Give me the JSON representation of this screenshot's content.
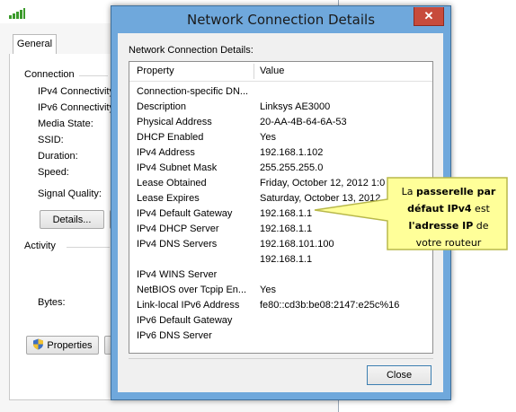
{
  "background_window": {
    "tab_general": "General",
    "connection_group": "Connection",
    "fields": [
      "IPv4 Connectivity:",
      "IPv6 Connectivity:",
      "Media State:",
      "SSID:",
      "Duration:",
      "Speed:"
    ],
    "signal_quality": "Signal Quality:",
    "details_button": "Details...",
    "activity_group": "Activity",
    "bytes_label": "Bytes:",
    "properties_button": "Properties"
  },
  "dialog": {
    "title": "Network Connection Details",
    "close_glyph": "✕",
    "label": "Network Connection Details:",
    "columns": {
      "property": "Property",
      "value": "Value"
    },
    "rows": [
      {
        "property": "Connection-specific DN...",
        "value": ""
      },
      {
        "property": "Description",
        "value": "Linksys AE3000"
      },
      {
        "property": "Physical Address",
        "value": "20-AA-4B-64-6A-53"
      },
      {
        "property": "DHCP Enabled",
        "value": "Yes"
      },
      {
        "property": "IPv4 Address",
        "value": "192.168.1.102"
      },
      {
        "property": "IPv4 Subnet Mask",
        "value": "255.255.255.0"
      },
      {
        "property": "Lease Obtained",
        "value": "Friday, October 12, 2012 1:0"
      },
      {
        "property": "Lease Expires",
        "value": "Saturday, October 13, 2012"
      },
      {
        "property": "IPv4 Default Gateway",
        "value": "192.168.1.1"
      },
      {
        "property": "IPv4 DHCP Server",
        "value": "192.168.1.1"
      },
      {
        "property": "IPv4 DNS Servers",
        "value": "192.168.101.100"
      },
      {
        "property": "",
        "value": "192.168.1.1"
      },
      {
        "property": "IPv4 WINS Server",
        "value": ""
      },
      {
        "property": "NetBIOS over Tcpip En...",
        "value": "Yes"
      },
      {
        "property": "Link-local IPv6 Address",
        "value": "fe80::cd3b:be08:2147:e25c%16"
      },
      {
        "property": "IPv6 Default Gateway",
        "value": ""
      },
      {
        "property": "IPv6 DNS Server",
        "value": ""
      }
    ],
    "close_button": "Close"
  },
  "callout": {
    "line1_pre": "La ",
    "line1_bold": "passerelle par",
    "line2_bold": "défaut IPv4",
    "line2_post": " est",
    "line3_bold": "l'adresse IP",
    "line3_post": " de",
    "line4": "votre routeur"
  },
  "colors": {
    "dialog_frame": "#6fa8dc",
    "close_red": "#c74b3c",
    "callout_fill": "#ffff99",
    "callout_border": "#b8b84a"
  }
}
